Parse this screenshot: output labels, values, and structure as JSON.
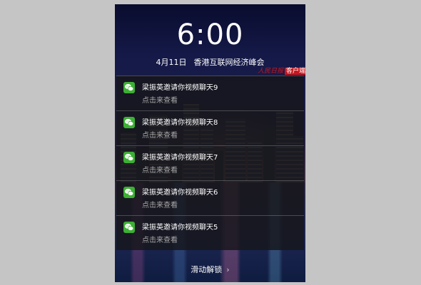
{
  "lockscreen": {
    "time": "6:00",
    "date": "4月11日",
    "event": "香港互联网经济峰会",
    "watermark_logo": "人民日报",
    "watermark_tag": "客户端",
    "unlock_label": "滑动解锁",
    "unlock_icon": "chevron-right-icon"
  },
  "notifications": [
    {
      "app_icon": "wechat-icon",
      "title": "梁振英邀请你视频聊天9",
      "subtitle": "点击来查看"
    },
    {
      "app_icon": "wechat-icon",
      "title": "梁振英邀请你视频聊天8",
      "subtitle": "点击来查看"
    },
    {
      "app_icon": "wechat-icon",
      "title": "梁振英邀请你视频聊天7",
      "subtitle": "点击来查看"
    },
    {
      "app_icon": "wechat-icon",
      "title": "梁振英邀请你视频聊天6",
      "subtitle": "点击来查看"
    },
    {
      "app_icon": "wechat-icon",
      "title": "梁振英邀请你视频聊天5",
      "subtitle": "点击来查看"
    }
  ],
  "colors": {
    "wechat_green": "#3cb034",
    "watermark_red": "#c8161e"
  }
}
